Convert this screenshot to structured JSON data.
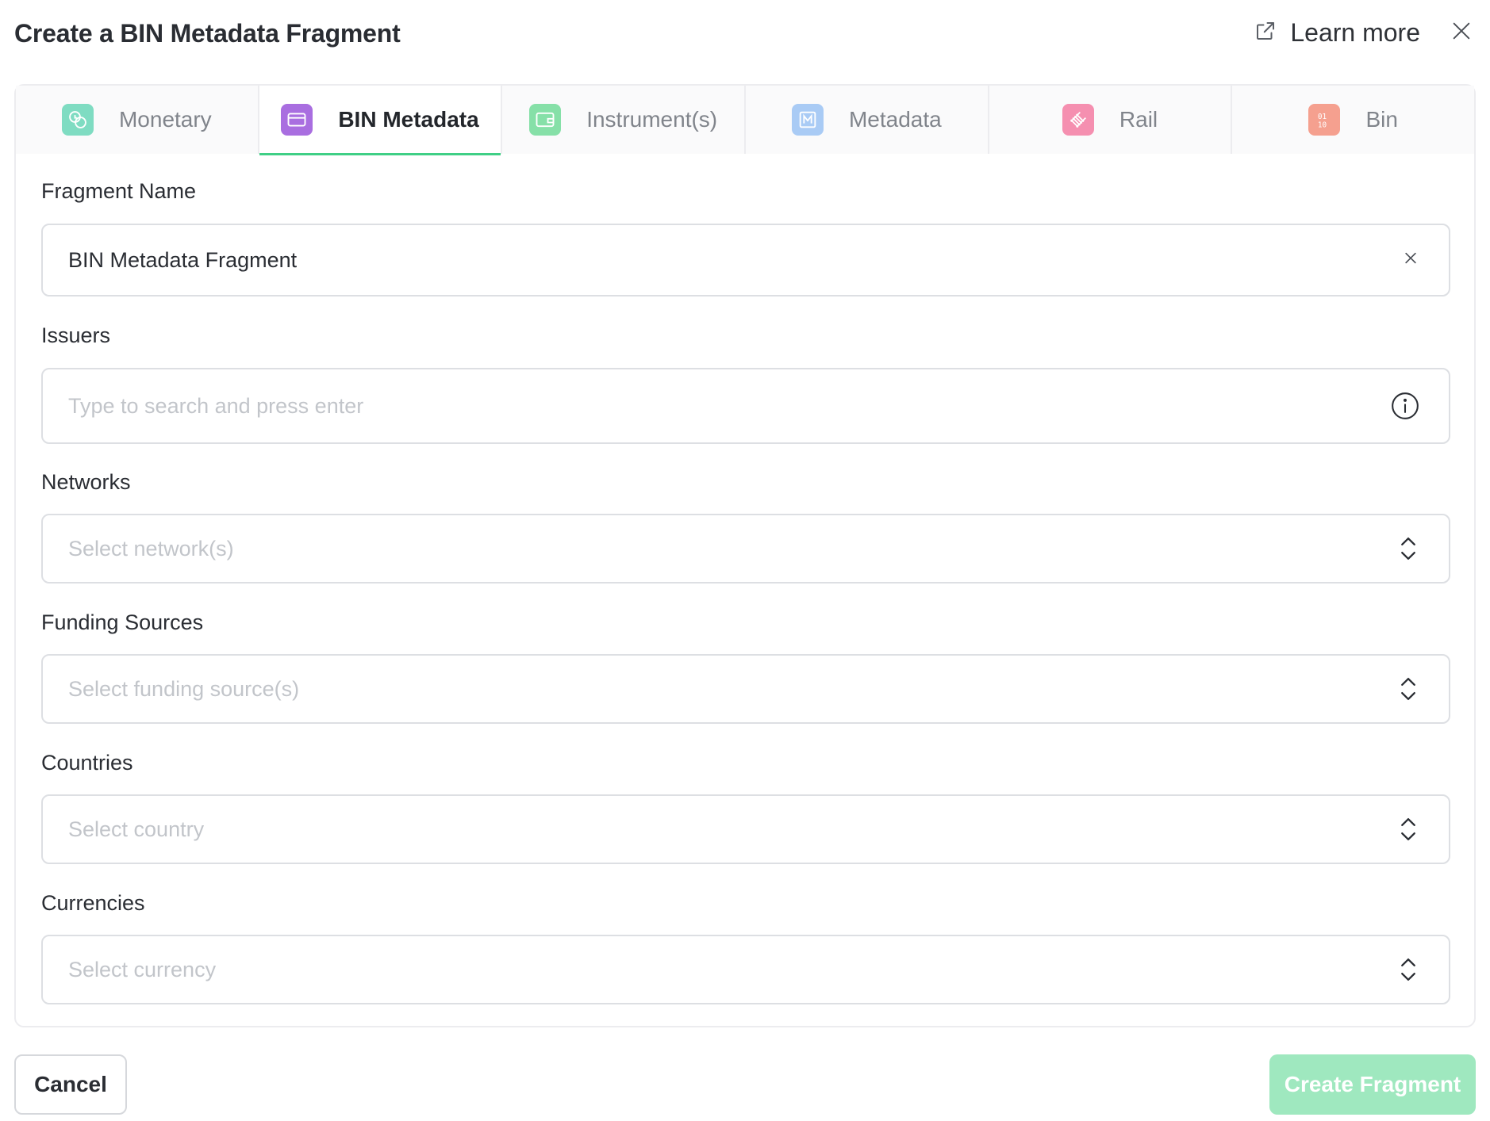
{
  "dialog": {
    "title": "Create a BIN Metadata Fragment",
    "learn_more": "Learn more"
  },
  "tabs": [
    {
      "label": "Monetary",
      "icon": "coins-icon",
      "color": "#7fdcc2",
      "active": false
    },
    {
      "label": "BIN Metadata",
      "icon": "credit-card-icon",
      "color": "#a96ee0",
      "active": true
    },
    {
      "label": "Instrument(s)",
      "icon": "wallet-icon",
      "color": "#86e0a8",
      "active": false
    },
    {
      "label": "Metadata",
      "icon": "m-box-icon",
      "color": "#a9cbf5",
      "active": false
    },
    {
      "label": "Rail",
      "icon": "rail-track-icon",
      "color": "#f58fb0",
      "active": false
    },
    {
      "label": "Bin",
      "icon": "binary-icon",
      "color": "#f5a08f",
      "active": false
    }
  ],
  "form": {
    "fragment_name": {
      "label": "Fragment Name",
      "value": "BIN Metadata Fragment"
    },
    "issuers": {
      "label": "Issuers",
      "placeholder": "Type to search and press enter"
    },
    "networks": {
      "label": "Networks",
      "placeholder": "Select network(s)"
    },
    "funding_sources": {
      "label": "Funding Sources",
      "placeholder": "Select funding source(s)"
    },
    "countries": {
      "label": "Countries",
      "placeholder": "Select country"
    },
    "currencies": {
      "label": "Currencies",
      "placeholder": "Select currency"
    }
  },
  "footer": {
    "cancel": "Cancel",
    "create": "Create Fragment"
  },
  "colors": {
    "accent": "#3fcf86",
    "create_button_disabled": "#9fe8bf"
  }
}
